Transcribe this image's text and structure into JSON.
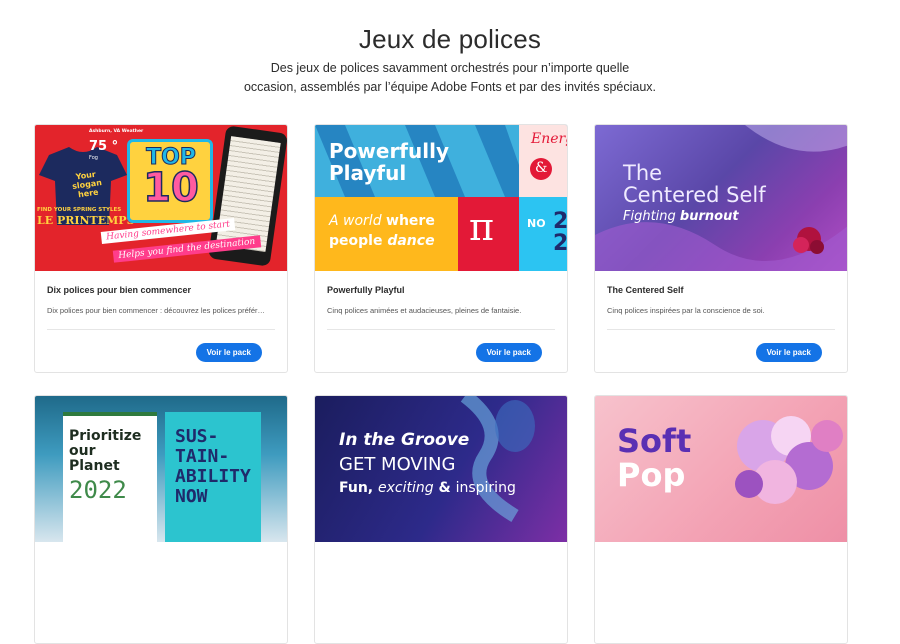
{
  "header": {
    "title": "Jeux de polices",
    "subtitle_line1": "Des jeux de polices savamment orchestrés pour n’importe quelle",
    "subtitle_line2": "occasion, assemblés par l’équipe Adobe Fonts et par des invités spéciaux."
  },
  "cards": [
    {
      "title": "Dix polices pour bien commencer",
      "description": "Dix polices pour bien commencer : découvrez les polices préfér…",
      "button_label": "Voir le pack",
      "art": {
        "top_line1": "TOP",
        "top_line2": "10",
        "banner1": "Having somewhere to start",
        "banner2": "Helps you find the destination",
        "tshirt_text": "Your slogan here",
        "weather_city": "Ashburn, VA Weather",
        "weather_temp": "75 °",
        "weather_cond": "Fog",
        "spring_line1": "FIND YOUR SPRING STYLES",
        "spring_line2": "LE PRINTEMPS"
      }
    },
    {
      "title": "Powerfully Playful",
      "description": "Cinq polices animées et audacieuses, pleines de fantaisie.",
      "button_label": "Voir le pack",
      "art": {
        "headline_line1": "Powerfully",
        "headline_line2": "Playful",
        "world_line1_a": "A world ",
        "world_line1_b": "where",
        "world_line2_a": "people ",
        "world_line2_b": "dance",
        "pi": "π",
        "energy": "Energ",
        "ampersand": "&",
        "no_label": "NO",
        "no_num": "2",
        "no_num2": "2"
      }
    },
    {
      "title": "The Centered Self",
      "description": "Cinq polices inspirées par la conscience de soi.",
      "button_label": "Voir le pack",
      "art": {
        "line1": "The",
        "line2": "Centered Self",
        "line3_a": "Fighting ",
        "line3_b": "burnout"
      }
    },
    {
      "art": {
        "line1": "Prioritize",
        "line2": "our",
        "line3": "Planet",
        "line4": "2022",
        "sus1": "SUS-",
        "sus2": "TAIN-",
        "sus3": "ABILITY",
        "sus4": "NOW"
      }
    },
    {
      "art": {
        "line1": "In the Groove",
        "line2": "GET MOVING",
        "line3_a": "Fun, ",
        "line3_b": "exciting",
        "line3_c": " & ",
        "line3_d": "inspiring"
      }
    },
    {
      "art": {
        "line1": "Soft",
        "line2": "Pop"
      }
    }
  ],
  "colors": {
    "button_blue": "#1473e6",
    "red": "#e01b24",
    "purple": "#5a47a8",
    "navy": "#1f2a6b",
    "pink": "#f3a2b4",
    "teal": "#2cc4cf"
  }
}
